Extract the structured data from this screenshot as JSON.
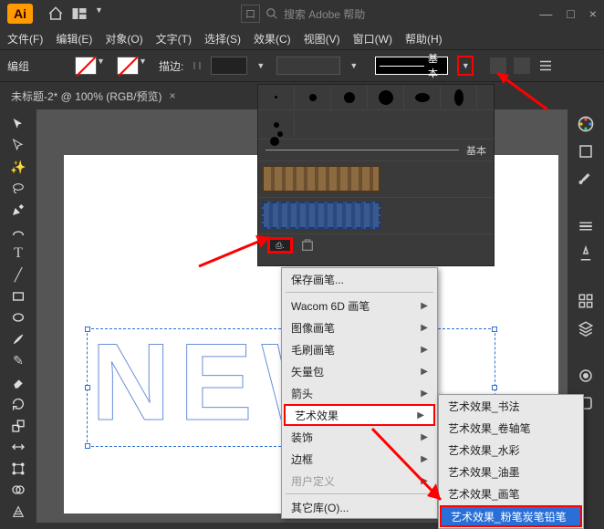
{
  "app": {
    "logo": "Ai"
  },
  "search": {
    "label": "搜索 Adobe 帮助",
    "tag": "口"
  },
  "menubar": [
    "文件(F)",
    "编辑(E)",
    "对象(O)",
    "文字(T)",
    "选择(S)",
    "效果(C)",
    "视图(V)",
    "窗口(W)",
    "帮助(H)"
  ],
  "control": {
    "mode": "编组",
    "stroke_label": "描边:",
    "basic": "基本"
  },
  "tab": {
    "title": "未标题-2* @ 100% (RGB/预览)",
    "close": "×"
  },
  "canvas_text": "NEW",
  "brush_panel": {
    "basic": "基本"
  },
  "ctx": {
    "items": [
      {
        "label": "保存画笔...",
        "arrow": false,
        "disabled": false
      },
      {
        "sep": true
      },
      {
        "label": "Wacom 6D 画笔",
        "arrow": true
      },
      {
        "label": "图像画笔",
        "arrow": true
      },
      {
        "label": "毛刷画笔",
        "arrow": true
      },
      {
        "label": "矢量包",
        "arrow": true
      },
      {
        "label": "箭头",
        "arrow": true
      },
      {
        "label": "艺术效果",
        "arrow": true,
        "hl": true
      },
      {
        "label": "装饰",
        "arrow": true
      },
      {
        "label": "边框",
        "arrow": true
      },
      {
        "label": "用户定义",
        "arrow": true,
        "disabled": true
      },
      {
        "sep": true
      },
      {
        "label": "其它库(O)...",
        "arrow": false
      }
    ]
  },
  "submenu": {
    "items": [
      "艺术效果_书法",
      "艺术效果_卷轴笔",
      "艺术效果_水彩",
      "艺术效果_油墨",
      "艺术效果_画笔",
      "艺术效果_粉笔炭笔铅笔"
    ],
    "selected_index": 5
  }
}
